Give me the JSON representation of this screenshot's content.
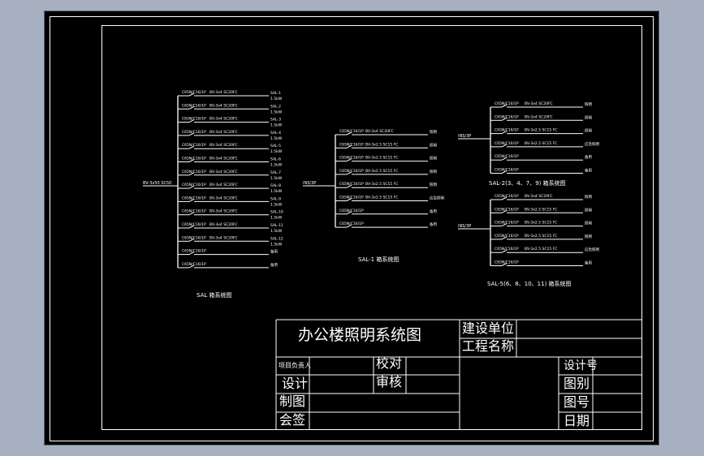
{
  "panels": {
    "left": {
      "caption": "SAL 箱系统图",
      "incoming": "BV-3x50 SC50",
      "circuits": [
        {
          "breaker": "C65N/C16/1P",
          "cable": "BV-3x4 SC20FC",
          "tag": "SAL-1",
          "load": "1.5kW"
        },
        {
          "breaker": "C65N/C16/1P",
          "cable": "BV-3x4 SC20FC",
          "tag": "SAL-2",
          "load": "1.5kW"
        },
        {
          "breaker": "C65N/C16/1P",
          "cable": "BV-3x4 SC20FC",
          "tag": "SAL-3",
          "load": "1.5kW"
        },
        {
          "breaker": "C65N/C16/1P",
          "cable": "BV-3x4 SC20FC",
          "tag": "SAL-4",
          "load": "1.5kW"
        },
        {
          "breaker": "C65N/C16/1P",
          "cable": "BV-3x4 SC20FC",
          "tag": "SAL-5",
          "load": "1.5kW"
        },
        {
          "breaker": "C65N/C16/1P",
          "cable": "BV-3x4 SC20FC",
          "tag": "SAL-6",
          "load": "1.5kW"
        },
        {
          "breaker": "C65N/C16/1P",
          "cable": "BV-3x4 SC20FC",
          "tag": "SAL-7",
          "load": "1.5kW"
        },
        {
          "breaker": "C65N/C16/1P",
          "cable": "BV-3x4 SC20FC",
          "tag": "SAL-8",
          "load": "1.5kW"
        },
        {
          "breaker": "C65N/C16/1P",
          "cable": "BV-3x4 SC20FC",
          "tag": "SAL-9",
          "load": "1.5kW"
        },
        {
          "breaker": "C65N/C16/1P",
          "cable": "BV-3x4 SC20FC",
          "tag": "SAL-10",
          "load": "1.5kW"
        },
        {
          "breaker": "C65N/C16/1P",
          "cable": "BV-3x4 SC20FC",
          "tag": "SAL-11",
          "load": "1.5kW"
        },
        {
          "breaker": "C65N/C16/1P",
          "cable": "BV-3x4 SC20FC",
          "tag": "SAL-12",
          "load": "1.5kW"
        },
        {
          "breaker": "C65N/C16/1P",
          "cable": "",
          "tag": "备用",
          "load": ""
        },
        {
          "breaker": "C65N/C16/1P",
          "cable": "",
          "tag": "备用",
          "load": ""
        }
      ]
    },
    "middle": {
      "caption": "SAL-1 箱系统图",
      "incoming": "INS/3P",
      "circuits": [
        {
          "breaker": "C65N/C16/1P",
          "cable": "BV-3x4 SC20FC",
          "load": "照明"
        },
        {
          "breaker": "C65N/C16/1P",
          "cable": "BV-3x2.5 SC15 FC",
          "load": "照明"
        },
        {
          "breaker": "C65N/C16/1P",
          "cable": "BV-3x2.5 SC15 FC",
          "load": "照明"
        },
        {
          "breaker": "C65N/C16/1P",
          "cable": "BV-3x2.5 SC15 FC",
          "load": "照明"
        },
        {
          "breaker": "C65N/C16/1P",
          "cable": "BV-3x2.5 SC15 FC",
          "load": "照明"
        },
        {
          "breaker": "C65N/C16/1P",
          "cable": "BV-3x2.5 SC15 FC",
          "load": "应急照明"
        },
        {
          "breaker": "C65N/C16/1P",
          "cable": "",
          "load": "备用"
        },
        {
          "breaker": "C65N/C16/1P",
          "cable": "",
          "load": "备用"
        }
      ]
    },
    "right_top": {
      "caption": "SAL-2(3、4、7、9) 箱系统图",
      "incoming": "INS/3P",
      "circuits": [
        {
          "breaker": "C65N/C16/1P",
          "cable": "BV-3x4 SC20FC",
          "load": "照明"
        },
        {
          "breaker": "C65N/C16/1P",
          "cable": "BV-3x4 SC20FC",
          "load": "照明"
        },
        {
          "breaker": "C65N/C16/1P",
          "cable": "BV-3x2.5 SC15 FC",
          "load": "照明"
        },
        {
          "breaker": "C65N/C16/1P",
          "cable": "BV-3x2.5 SC15 FC",
          "load": "应急照明"
        },
        {
          "breaker": "C65N/C16/1P",
          "cable": "",
          "load": "备用"
        },
        {
          "breaker": "C65N/C16/1P",
          "cable": "",
          "load": "备用"
        }
      ]
    },
    "right_bottom": {
      "caption": "SAL-5(6、8、10、11) 箱系统图",
      "incoming": "INS/3P",
      "circuits": [
        {
          "breaker": "C65N/C16/1P",
          "cable": "BV-3x4 SC20FC",
          "load": "照明"
        },
        {
          "breaker": "C65N/C16/1P",
          "cable": "BV-3x2.5 SC15 FC",
          "load": "照明"
        },
        {
          "breaker": "C65N/C16/1P",
          "cable": "BV-3x2.5 SC15 FC",
          "load": "照明"
        },
        {
          "breaker": "C65N/C16/1P",
          "cable": "BV-3x2.5 SC15 FC",
          "load": "照明"
        },
        {
          "breaker": "C65N/C16/1P",
          "cable": "BV-3x2.5 SC15 FC",
          "load": "应急照明"
        },
        {
          "breaker": "C65N/C16/1P",
          "cable": "",
          "load": "备用"
        }
      ]
    }
  },
  "title_block": {
    "drawing_title": "办公楼照明系统图",
    "unit_label": "建设单位",
    "project_label": "工程名称",
    "lead_label": "项目负责人",
    "check_label": "校对",
    "design_label": "设计",
    "review_label": "审核",
    "draw_label": "制图",
    "countersign_label": "会签",
    "design_no_label": "设计号",
    "category_label": "图别",
    "drawing_no_label": "图号",
    "date_label": "日期"
  },
  "colors": {
    "background": "#000000",
    "lines": "#ffffff",
    "frame_outer": "#a7b0c0"
  }
}
